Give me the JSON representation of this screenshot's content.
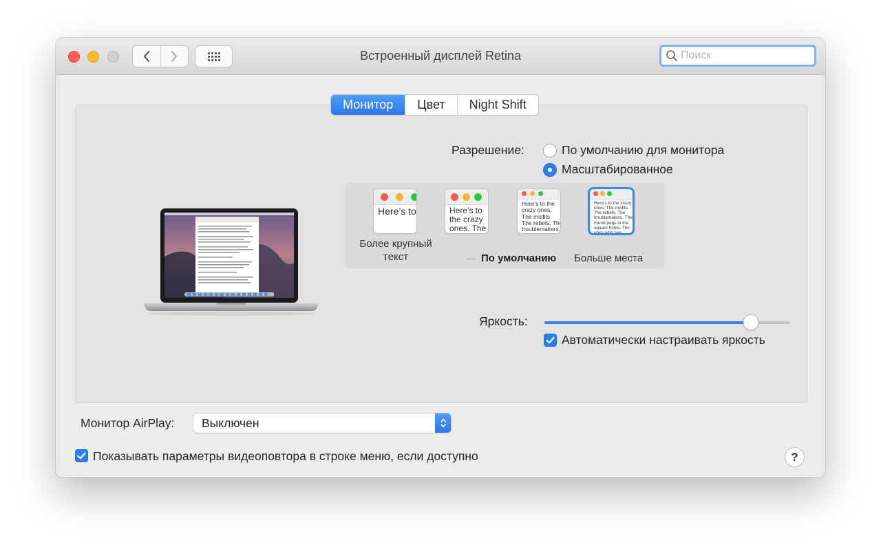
{
  "window": {
    "title": "Встроенный дисплей Retina"
  },
  "search": {
    "placeholder": "Поиск"
  },
  "tabs": [
    {
      "label": "Монитор",
      "active": true
    },
    {
      "label": "Цвет",
      "active": false
    },
    {
      "label": "Night Shift",
      "active": false
    }
  ],
  "resolution": {
    "label": "Разрешение:",
    "options": [
      {
        "label": "По умолчанию для монитора",
        "selected": false
      },
      {
        "label": "Масштабированное",
        "selected": true
      }
    ],
    "previews": [
      {
        "text": "Here’s to the crazy ones. The misfits. The rebels. The troublemakers.",
        "selected": false
      },
      {
        "text": "Here’s to the crazy ones. The misfits. The rebels. The troublemakers.",
        "selected": false
      },
      {
        "text": "Here’s to the crazy ones. The misfits. The rebels. The troublemakers. The round pegs in the square holes. The ones who see things differently. They're not fond of rules. And they have no respect for the status quo.",
        "selected": false
      },
      {
        "text": "Here’s to the crazy ones. The misfits. The rebels. The troublemakers. The round pegs in the square holes. The ones who see things differently. They're not fond of rules. And they have no respect for the status quo. You can quote them, disagree with them. About the only thing you can't do is ignore them. Because they change things.",
        "selected": true
      }
    ],
    "scale_labels": {
      "larger_line1": "Более крупный",
      "larger_line2": "текст",
      "default": "По умолчанию",
      "more_space": "Больше места"
    }
  },
  "brightness": {
    "label": "Яркость:",
    "value_percent": 84,
    "auto_label": "Автоматически настраивать яркость",
    "auto_checked": true
  },
  "airplay": {
    "label": "Монитор AirPlay:",
    "value": "Выключен"
  },
  "mirroring": {
    "label": "Показывать параметры видеоповтора в строке меню, если доступно",
    "checked": true
  },
  "help": {
    "label": "?"
  },
  "colors": {
    "accent": "#2d7ff0",
    "close": "#fe5f57",
    "minimize": "#febb2e",
    "zoom_disabled": "#d0d0d0",
    "dot_red": "#f25a51",
    "dot_yellow": "#f6b52f",
    "dot_green": "#29c840"
  }
}
